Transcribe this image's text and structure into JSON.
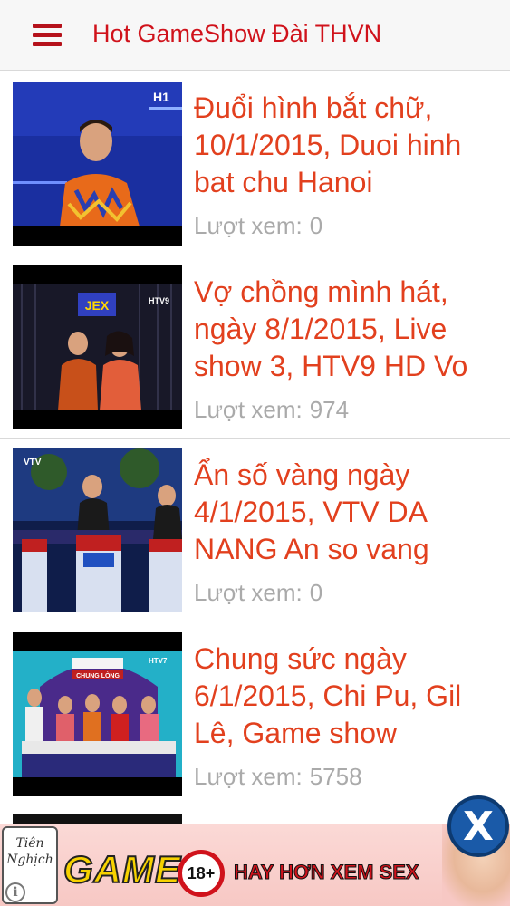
{
  "header": {
    "title": "Hot GameShow Đài THVN",
    "menu_icon": "hamburger-menu-icon"
  },
  "views_label": "Lượt xem:",
  "videos": [
    {
      "title": "Đuổi hình bắt chữ, 10/1/2015, Duoi hinh bat chu Hanoi",
      "views": "0",
      "channel": "H1"
    },
    {
      "title": "Vợ chồng mình hát, ngày 8/1/2015, Live show 3, HTV9 HD Vo",
      "views": "974",
      "channel": "HTV9",
      "stage_sign": "JEX"
    },
    {
      "title": "Ẩn số vàng ngày 4/1/2015, VTV DA NANG An so vang",
      "views": "0",
      "channel": "VTV"
    },
    {
      "title": "Chung sức ngày 6/1/2015, Chi Pu, Gil Lê, Game show",
      "views": "5758",
      "channel": "HTV7",
      "stage_sign": "CHUNG LÒNG"
    }
  ],
  "ad": {
    "game": "GAME",
    "age": "18+",
    "text": "HAY HƠN XEM SEX",
    "close": "X",
    "info": "i",
    "logo": "Tiên Nghịch"
  }
}
